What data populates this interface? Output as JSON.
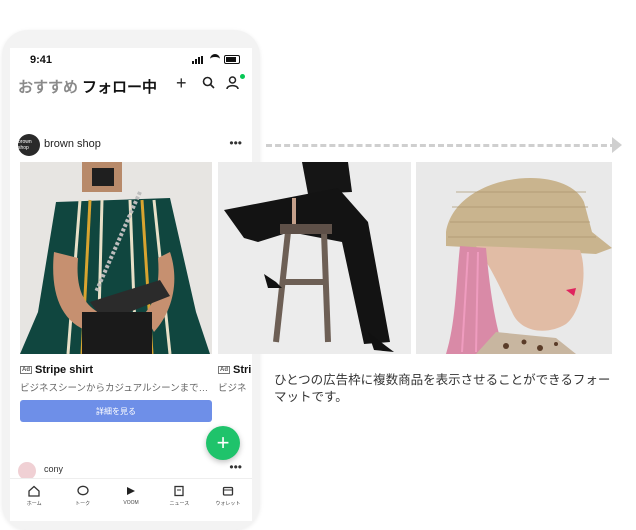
{
  "status": {
    "time": "9:41"
  },
  "header": {
    "tab_recommend": "おすすめ",
    "tab_following": "フォロー中"
  },
  "shop": {
    "name": "brown shop",
    "avatar_text": "brown shop"
  },
  "products": [
    {
      "title": "Stripe shirt",
      "desc": "ビジネスシーンからカジュアルシーンまで…",
      "ad": "Ad"
    },
    {
      "title": "Stri",
      "desc": "ビジネ",
      "ad": "Ad"
    }
  ],
  "cta": {
    "label": "詳細を見る"
  },
  "user": {
    "name": "cony"
  },
  "nav": [
    {
      "label": "ホーム",
      "icon": "home-icon"
    },
    {
      "label": "トーク",
      "icon": "chat-icon"
    },
    {
      "label": "VOOM",
      "icon": "voom-icon"
    },
    {
      "label": "ニュース",
      "icon": "news-icon"
    },
    {
      "label": "ウォレット",
      "icon": "wallet-icon"
    }
  ],
  "description": "ひとつの広告枠に複数商品を表示させることができるフォーマットです。",
  "colors": {
    "accent_button": "#6e8fe8",
    "fab": "#1fc36b",
    "arrow": "#cfcfcf"
  }
}
